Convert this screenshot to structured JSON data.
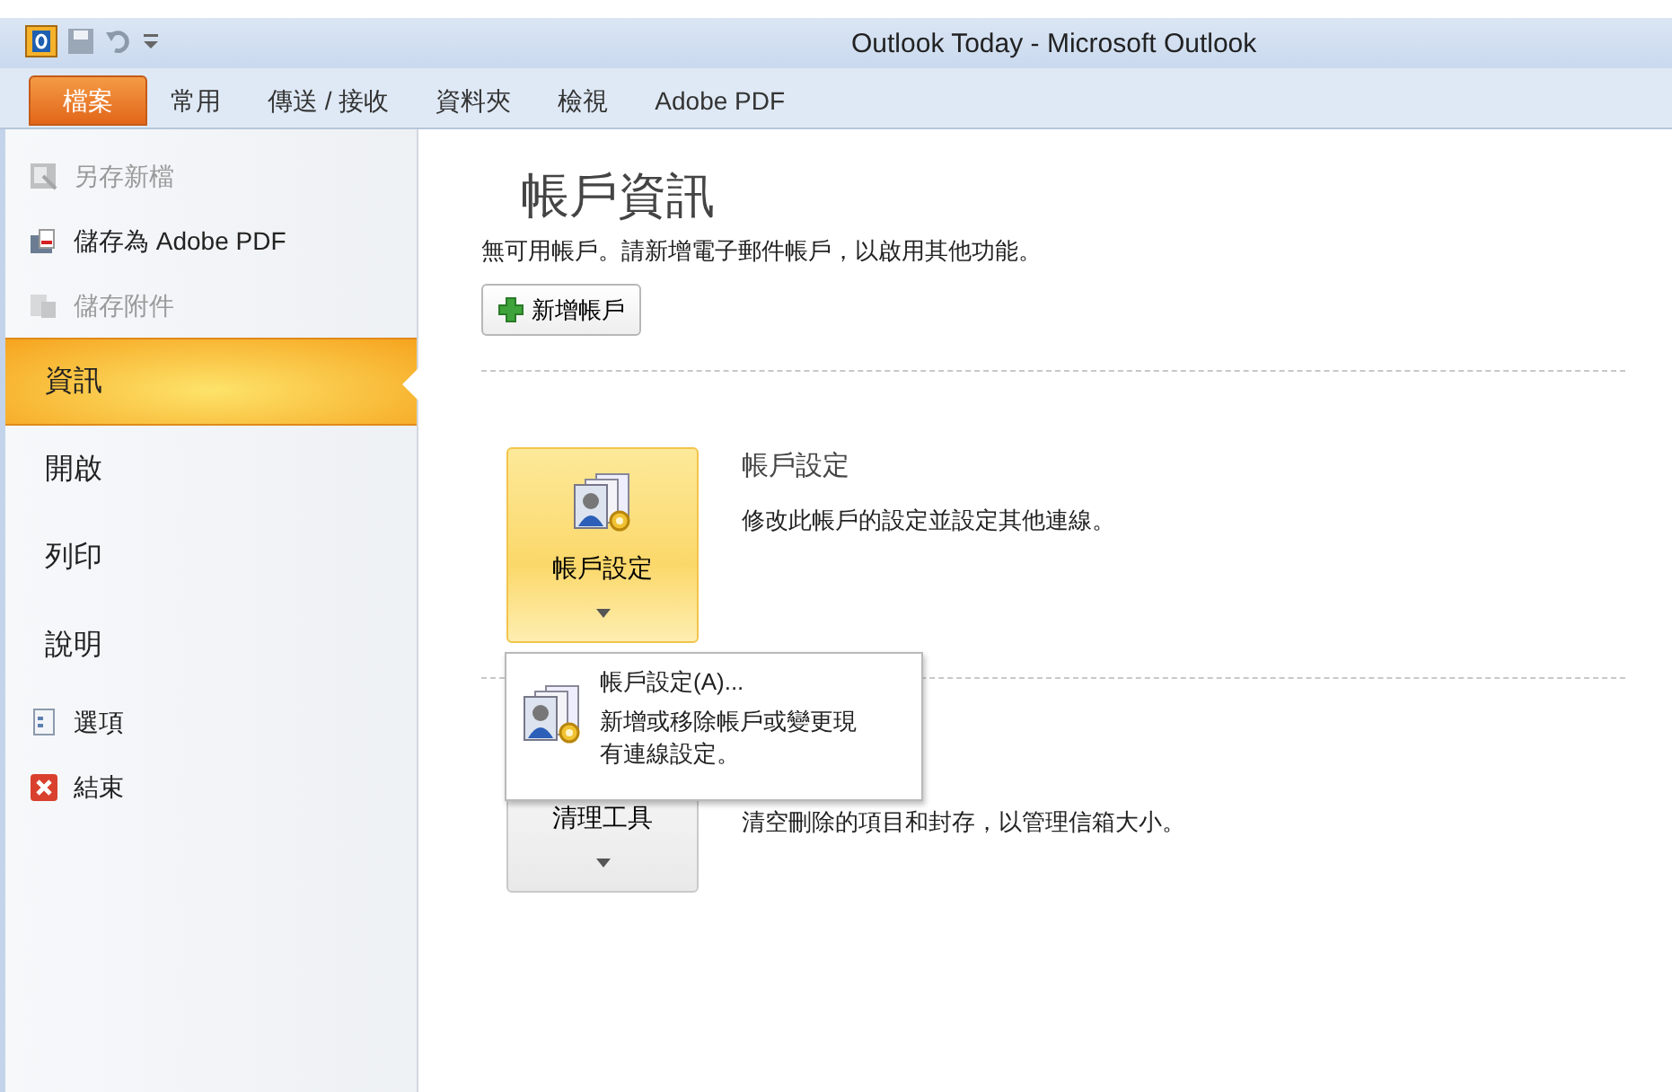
{
  "window": {
    "title": "Outlook Today - Microsoft Outlook"
  },
  "ribbon_tabs": [
    {
      "label": "檔案",
      "selected": true
    },
    {
      "label": "常用",
      "selected": false
    },
    {
      "label": "傳送 / 接收",
      "selected": false
    },
    {
      "label": "資料夾",
      "selected": false
    },
    {
      "label": "檢視",
      "selected": false
    },
    {
      "label": "Adobe PDF",
      "selected": false
    }
  ],
  "sidebar": {
    "items": [
      {
        "kind": "command",
        "label": "另存新檔",
        "disabled": true
      },
      {
        "kind": "command",
        "label": "儲存為 Adobe PDF",
        "disabled": false
      },
      {
        "kind": "command",
        "label": "儲存附件",
        "disabled": true
      },
      {
        "kind": "tab",
        "label": "資訊",
        "selected": true
      },
      {
        "kind": "tab",
        "label": "開啟",
        "selected": false
      },
      {
        "kind": "tab",
        "label": "列印",
        "selected": false
      },
      {
        "kind": "tab",
        "label": "說明",
        "selected": false
      },
      {
        "kind": "command",
        "label": "選項",
        "disabled": false
      },
      {
        "kind": "command",
        "label": "結束",
        "disabled": false
      }
    ]
  },
  "main": {
    "title": "帳戶資訊",
    "message": "無可用帳戶。請新增電子郵件帳戶，以啟用其他功能。",
    "add_button": "新增帳戶",
    "sections": [
      {
        "button": "帳戶設定",
        "highlighted": true,
        "heading": "帳戶設定",
        "description": "修改此帳戶的設定並設定其他連線。"
      },
      {
        "button": "清理工具",
        "highlighted": false,
        "description": "清空刪除的項目和封存，以管理信箱大小。"
      }
    ]
  },
  "dropdown_menu": {
    "items": [
      {
        "title": "帳戶設定(A)...",
        "description": "新增或移除帳戶或變更現有連線設定。"
      }
    ]
  }
}
